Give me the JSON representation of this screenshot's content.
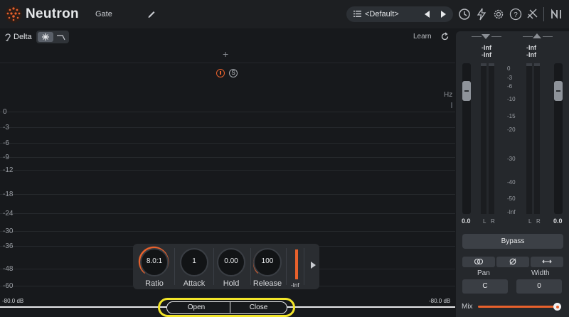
{
  "header": {
    "app_name": "Neutron",
    "module_name": "Gate",
    "preset_name": "<Default>",
    "icons": [
      "neutron-logo",
      "pencil-icon",
      "list-icon",
      "prev-arrow-icon",
      "next-arrow-icon",
      "history-icon",
      "lightning-icon",
      "gear-icon",
      "help-icon",
      "ni-logo-icon"
    ]
  },
  "subbar": {
    "delta_label": "Delta",
    "learn_label": "Learn"
  },
  "graph": {
    "hz_label": "Hz",
    "db_scale": [
      "0",
      "-3",
      "-6",
      "-9",
      "-12",
      "-18",
      "-24",
      "-30",
      "-36",
      "-48",
      "-60"
    ],
    "floor_left": "-80.0 dB",
    "floor_right": "-80.0 dB"
  },
  "band": {
    "solo_state": "active",
    "s_label": "S"
  },
  "controls": {
    "ratio": {
      "value": "8.0:1",
      "label": "Ratio",
      "level": 0.9
    },
    "attack": {
      "value": "1",
      "label": "Attack",
      "level": 0.0
    },
    "hold": {
      "value": "0.00",
      "label": "Hold",
      "level": 0.0
    },
    "release": {
      "value": "100",
      "label": "Release",
      "level": 0.4
    },
    "gain_reduction_label": "-Inf"
  },
  "mode_buttons": {
    "open": "Open",
    "close": "Close"
  },
  "meters": {
    "in_peak": "-Inf",
    "in_rms": "-Inf",
    "out_peak": "-Inf",
    "out_rms": "-Inf",
    "scale": [
      "0",
      "-3",
      "-6",
      "-10",
      "-15",
      "-20",
      "-30",
      "-40",
      "-50",
      "-Inf"
    ],
    "l_label": "L",
    "r_label": "R",
    "in_fader": "0.0",
    "out_fader": "0.0"
  },
  "output": {
    "bypass_label": "Bypass",
    "stereo_icons": [
      "stereo-link-icon",
      "phase-invert-icon",
      "swap-channels-icon"
    ],
    "pan_label": "Pan",
    "pan_value": "C",
    "width_label": "Width",
    "width_value": "0",
    "mix_label": "Mix",
    "mix_level": 1.0
  },
  "colors": {
    "accent": "#e8612c",
    "highlight": "#f2e52a",
    "background": "#17191c"
  }
}
